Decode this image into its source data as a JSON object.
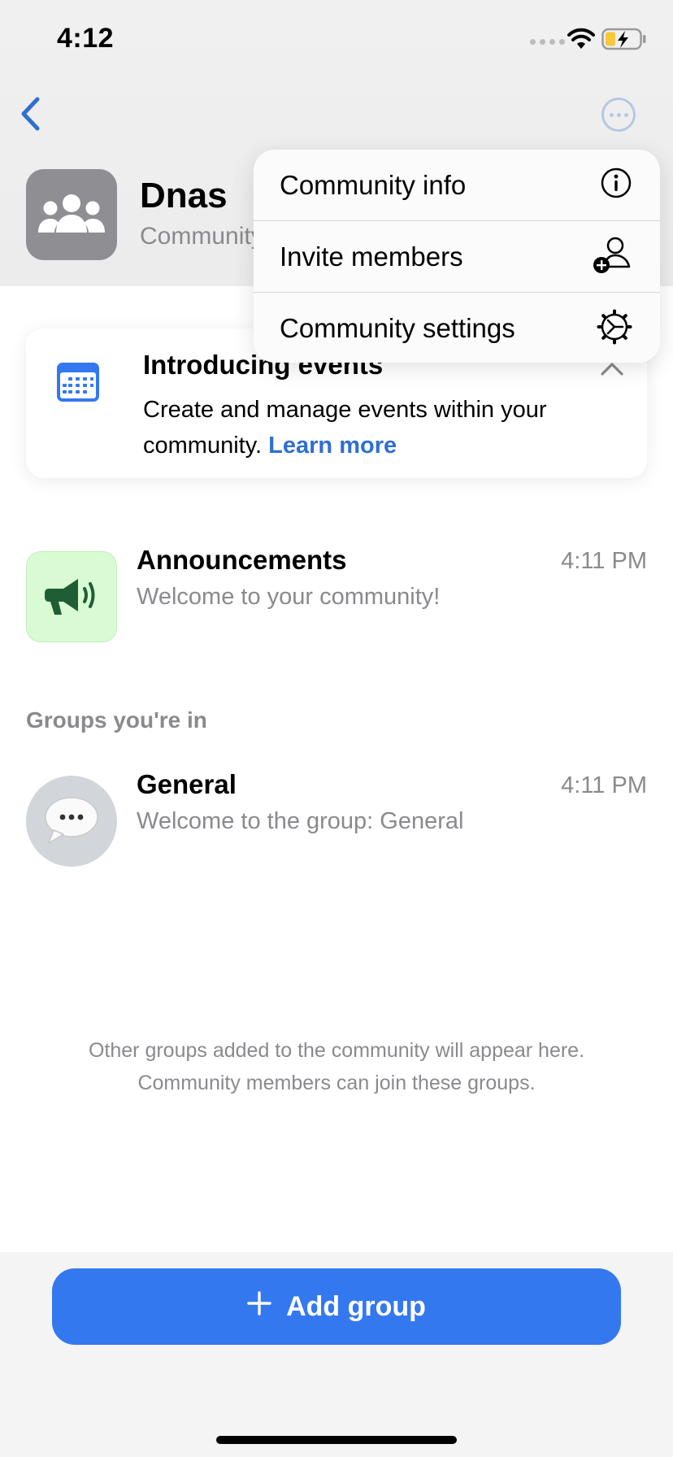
{
  "status_bar": {
    "time": "4:12"
  },
  "community": {
    "name": "Dnas",
    "subtitle": "Community"
  },
  "menu": {
    "items": [
      {
        "label": "Community info",
        "icon": "info-icon"
      },
      {
        "label": "Invite members",
        "icon": "add-person-icon"
      },
      {
        "label": "Community settings",
        "icon": "gear-icon"
      }
    ]
  },
  "events_card": {
    "title": "Introducing events",
    "body": "Create and manage events within your community.",
    "link": "Learn more"
  },
  "announcements": {
    "title": "Announcements",
    "message": "Welcome to your community!",
    "time": "4:11 PM"
  },
  "groups_section": {
    "label": "Groups you're in"
  },
  "groups": [
    {
      "title": "General",
      "message": "Welcome to the group: General",
      "time": "4:11 PM"
    }
  ],
  "footer_note": {
    "line1": "Other groups added to the community will appear here.",
    "line2": "Community members can join these groups."
  },
  "actions": {
    "add_group": "Add group"
  },
  "colors": {
    "accent": "#3478f0",
    "link": "#2f6fd0",
    "announcement_bg": "#d9fbd3"
  }
}
